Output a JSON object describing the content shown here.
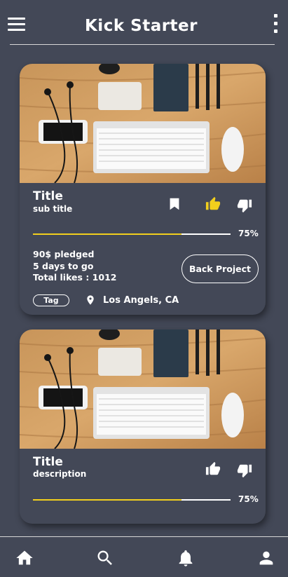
{
  "header": {
    "title": "Kick Starter",
    "menu_icon": "hamburger-menu-icon",
    "more_icon": "more-vertical-icon"
  },
  "colors": {
    "background": "#434857",
    "accent": "#f2cf1d",
    "text": "#ffffff"
  },
  "cards": [
    {
      "title": "Title",
      "subtitle": "sub title",
      "progress": 0.75,
      "progress_label": "75%",
      "pledged": "90$ pledged",
      "days_left": "5 days to go",
      "likes": "Total likes : 1012",
      "back_label": "Back Project",
      "tag": "Tag",
      "location": "Los Angels, CA",
      "icons": [
        "bookmark-icon",
        "thumbs-up-icon",
        "thumbs-down-icon",
        "location-pin-icon"
      ],
      "liked": true
    },
    {
      "title": "Title",
      "subtitle": "description",
      "progress": 0.75,
      "progress_label": "75%",
      "icons": [
        "thumbs-up-icon",
        "thumbs-down-icon"
      ],
      "liked": false
    }
  ],
  "bottom_nav": [
    "home-icon",
    "search-icon",
    "bell-icon",
    "profile-icon"
  ]
}
